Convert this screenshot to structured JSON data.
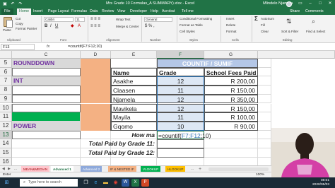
{
  "titlebar": {
    "title": "Mrs Grade 10 Formulas_A SUMMARY).xlsx - Excel",
    "user": "Mlindelo Njamela",
    "minimize": "–",
    "maximize": "□",
    "close": "✕"
  },
  "ribbon_tabs": [
    {
      "label": "File"
    },
    {
      "label": "Home"
    },
    {
      "label": "Insert"
    },
    {
      "label": "Page Layout"
    },
    {
      "label": "Formulas"
    },
    {
      "label": "Data"
    },
    {
      "label": "Review"
    },
    {
      "label": "View"
    },
    {
      "label": "Developer"
    },
    {
      "label": "Help"
    },
    {
      "label": "Acrobat"
    },
    {
      "label": "Tell me"
    }
  ],
  "ribbon_right": {
    "share": "Share",
    "comments": "Comments"
  },
  "ribbon": {
    "paste": "Paste",
    "cut": "Cut",
    "copy": "Copy",
    "format_painter": "Format Painter",
    "font_name": "Calibri",
    "font_size": "11",
    "wrap_text": "Wrap Text",
    "merge_center": "Merge & Center",
    "number_format": "General",
    "conditional_formatting": "Conditional Formatting",
    "format_as_table": "Format as Table",
    "cell_styles": "Cell Styles",
    "insert": "Insert",
    "delete": "Delete",
    "format": "Format",
    "autosum": "AutoSum",
    "fill": "Fill",
    "clear": "Clear",
    "sort_filter": "Sort & Filter",
    "find_select": "Find & Select",
    "groups": {
      "clipboard": "Clipboard",
      "font": "Font",
      "alignment": "Alignment",
      "number": "Number",
      "styles": "Styles",
      "cells": "Cells",
      "editing": "Editing"
    }
  },
  "formula_bar": {
    "name_box": "F13",
    "fx": "fx",
    "formula": "=countif(F7:F12;10)"
  },
  "columns": [
    {
      "id": "B",
      "label": ""
    },
    {
      "id": "C",
      "label": "C"
    },
    {
      "id": "D",
      "label": "D"
    },
    {
      "id": "E",
      "label": "E"
    },
    {
      "id": "F",
      "label": "F"
    },
    {
      "id": "G",
      "label": "G"
    }
  ],
  "rows": [
    {
      "num": "5",
      "c": "ROUNDDOWN",
      "e": "",
      "f": "COUNTIF / SUMIF",
      "g": ""
    },
    {
      "num": "6",
      "c": "",
      "e": "Name",
      "f": "Grade",
      "g": "School Fees Paid"
    },
    {
      "num": "7",
      "c": "INT",
      "e": "Asakhe",
      "f": "12",
      "g": "R 200,00"
    },
    {
      "num": "8",
      "c": "",
      "e": "Claasen",
      "f": "11",
      "g": "R 150,00"
    },
    {
      "num": "9",
      "c": "",
      "e": "Njamela",
      "f": "12",
      "g": "R 350,00"
    },
    {
      "num": "10",
      "c": "",
      "e": "Mavikela",
      "f": "12",
      "g": "R 150,00"
    },
    {
      "num": "11",
      "c": "",
      "e": "Mayila",
      "f": "11",
      "g": "R 100,00"
    },
    {
      "num": "12",
      "c": "POWER",
      "e": "Gqomo",
      "f": "10",
      "g": "R 90,00"
    },
    {
      "num": "13",
      "c": "",
      "e": "How ma",
      "f": "=countif(F7:F12;10)",
      "g": ""
    },
    {
      "num": "14",
      "c": "",
      "e": "Total Paid by Grade 11:",
      "f": "",
      "g": ""
    },
    {
      "num": "15",
      "c": "",
      "e": "Total Paid by Grade 12:",
      "f": "",
      "g": ""
    },
    {
      "num": "16",
      "c": "",
      "e": "",
      "f": "",
      "g": ""
    }
  ],
  "formula_parts": {
    "prefix": "=countif(",
    "range": "F7:F12",
    "suffix": ";10)"
  },
  "sheet_tabs": [
    {
      "label": "MEAN&MEDIAN"
    },
    {
      "label": "Advanced 1"
    },
    {
      "label": "Advanced 2"
    },
    {
      "label": "IF & NESTED IF"
    },
    {
      "label": "VLOOKUP"
    },
    {
      "label": "HLOOKUP"
    }
  ],
  "sheet_nav": {
    "add": "+",
    "more": "..."
  },
  "status": {
    "mode": "Enter",
    "zoom": "100%"
  },
  "taskbar": {
    "search_placeholder": "Type here to search",
    "time": "08:01",
    "date": "2020/05/03"
  },
  "colors": {
    "excel_green": "#217346",
    "orange_fill": "#f4b183",
    "purple_text": "#7030a0",
    "grey_fill": "#d9d9d9",
    "green_fill": "#00b050",
    "header_fill": "#b4c7e7",
    "blue_formula_ref": "#2e75b6"
  }
}
